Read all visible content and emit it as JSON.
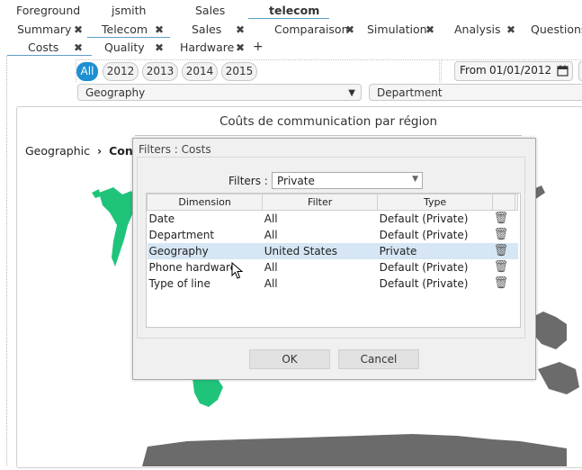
{
  "tabs_row1": [
    {
      "label": "Foreground"
    },
    {
      "label": "jsmith"
    },
    {
      "label": "Sales"
    },
    {
      "label": "telecom"
    }
  ],
  "tabs_row2": [
    {
      "label": "Summary"
    },
    {
      "label": "Telecom"
    },
    {
      "label": "Sales"
    },
    {
      "label": "Comparaison"
    },
    {
      "label": "Simulation"
    },
    {
      "label": "Analysis"
    },
    {
      "label": "Questions"
    }
  ],
  "tabs_row3": [
    {
      "label": "Costs"
    },
    {
      "label": "Quality"
    },
    {
      "label": "Hardware"
    }
  ],
  "add_tab_label": "+",
  "close_glyph": "✖",
  "years": [
    "All",
    "2012",
    "2013",
    "2014",
    "2015"
  ],
  "date_filter": {
    "label": "From",
    "value": "01/01/2012"
  },
  "geography_select": "Geography",
  "department_select": "Department",
  "chart": {
    "title": "Coûts de communication par région"
  },
  "breadcrumb": {
    "root": "Geographic",
    "current": "Contin"
  },
  "dialog": {
    "title": "Filters : Costs",
    "filters_label": "Filters :",
    "filters_value": "Private",
    "columns": [
      "Dimension",
      "Filter",
      "Type"
    ],
    "rows": [
      {
        "dimension": "Date",
        "filter": "All",
        "type": "Default (Private)"
      },
      {
        "dimension": "Department",
        "filter": "All",
        "type": "Default (Private)"
      },
      {
        "dimension": "Geography",
        "filter": "United States",
        "type": "Private"
      },
      {
        "dimension": "Phone hardware",
        "filter": "All",
        "type": "Default (Private)"
      },
      {
        "dimension": "Type of line",
        "filter": "All",
        "type": "Default (Private)"
      }
    ],
    "ok_label": "OK",
    "cancel_label": "Cancel"
  },
  "colors": {
    "accent": "#1e8fd2",
    "map_green": "#1fc47a",
    "map_grey": "#6b6b6b",
    "selected_row": "#d6e6f5"
  }
}
